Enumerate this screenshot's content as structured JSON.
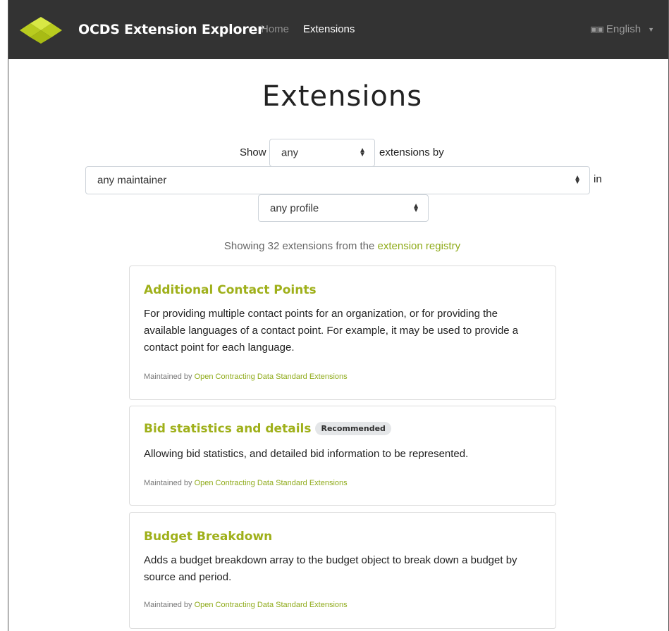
{
  "navbar": {
    "brand": "OCDS Extension Explorer",
    "links": [
      {
        "label": "Home"
      },
      {
        "label": "Extensions"
      }
    ],
    "language": "English"
  },
  "page": {
    "title": "Extensions"
  },
  "filters": {
    "show_label": "Show",
    "status_value": "any",
    "extensions_by_label": "extensions by",
    "maintainer_value": "any maintainer",
    "in_label": "in",
    "profile_value": "any profile"
  },
  "summary": {
    "text": "Showing 32 extensions from the",
    "link": "extension registry"
  },
  "extensions": [
    {
      "title": "Additional Contact Points",
      "badge": "",
      "description": "For providing multiple contact points for an organization, or for providing the available languages of a contact point. For example, it may be used to provide a contact point for each language.",
      "maintained_by_label": "Maintained by",
      "maintainer": "Open Contracting Data Standard Extensions"
    },
    {
      "title": "Bid statistics and details",
      "badge": "Recommended",
      "description": "Allowing bid statistics, and detailed bid information to be represented.",
      "maintained_by_label": "Maintained by",
      "maintainer": "Open Contracting Data Standard Extensions"
    },
    {
      "title": "Budget Breakdown",
      "badge": "",
      "description": "Adds a budget breakdown array to the budget object to break down a budget by source and period.",
      "maintained_by_label": "Maintained by",
      "maintainer": "Open Contracting Data Standard Extensions"
    }
  ],
  "colors": {
    "navbar_bg": "#333333",
    "accent": "#9fb01a",
    "logo": "#c5d826"
  }
}
